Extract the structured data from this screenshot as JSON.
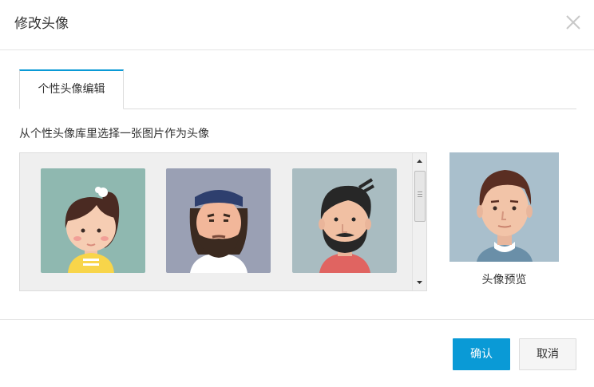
{
  "dialog": {
    "title": "修改头像",
    "close_icon": "close-icon"
  },
  "tabs": [
    {
      "label": "个性头像编辑",
      "active": true
    }
  ],
  "instruction": "从个性头像库里选择一张图片作为头像",
  "gallery": {
    "avatars": [
      {
        "name": "girl-ponytail-avatar",
        "bg": "#8fb8b0"
      },
      {
        "name": "man-headband-beard-avatar",
        "bg": "#9aa0b4"
      },
      {
        "name": "man-black-hair-beard-avatar",
        "bg": "#a9bcc1"
      }
    ],
    "scrollbar": {
      "up_icon": "arrow-up-icon",
      "down_icon": "arrow-down-icon"
    }
  },
  "preview": {
    "label": "头像预览",
    "bg": "#a9bfcc"
  },
  "buttons": {
    "confirm_label": "确认",
    "cancel_label": "取消"
  },
  "colors": {
    "accent": "#0a9ad6",
    "border": "#dcdcdc"
  }
}
